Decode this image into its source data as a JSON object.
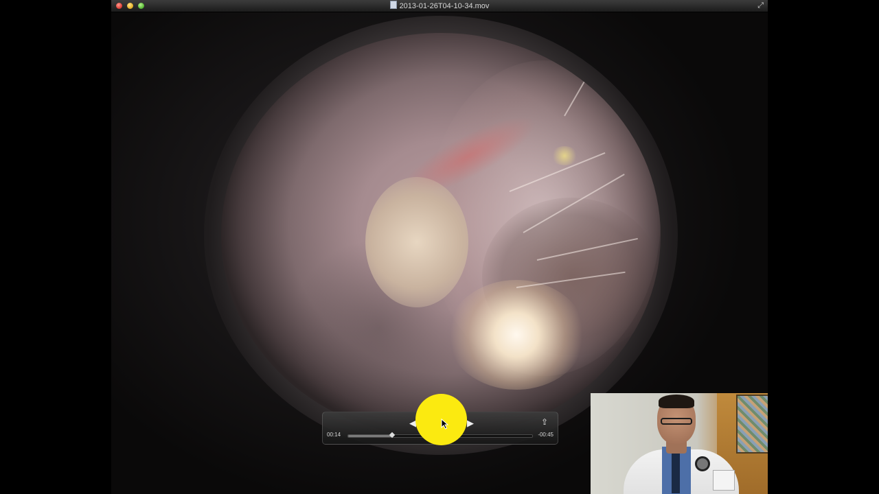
{
  "window": {
    "title": "2013-01-26T04-10-34.mov",
    "file_icon": "document-icon",
    "fullscreen_icon": "fullscreen-arrows-icon"
  },
  "player": {
    "current_time": "00:14",
    "remaining_time": "-00:45",
    "progress": 0.24,
    "icons": {
      "previous": "rewind-triangle-icon",
      "play": "play-icon",
      "next": "forward-triangle-icon",
      "share": "share-icon"
    }
  },
  "colors": {
    "click_highlight": "#fbea10",
    "titlebar": "#2a2a2a"
  },
  "overlay": {
    "webcam": "presenter-webcam"
  }
}
